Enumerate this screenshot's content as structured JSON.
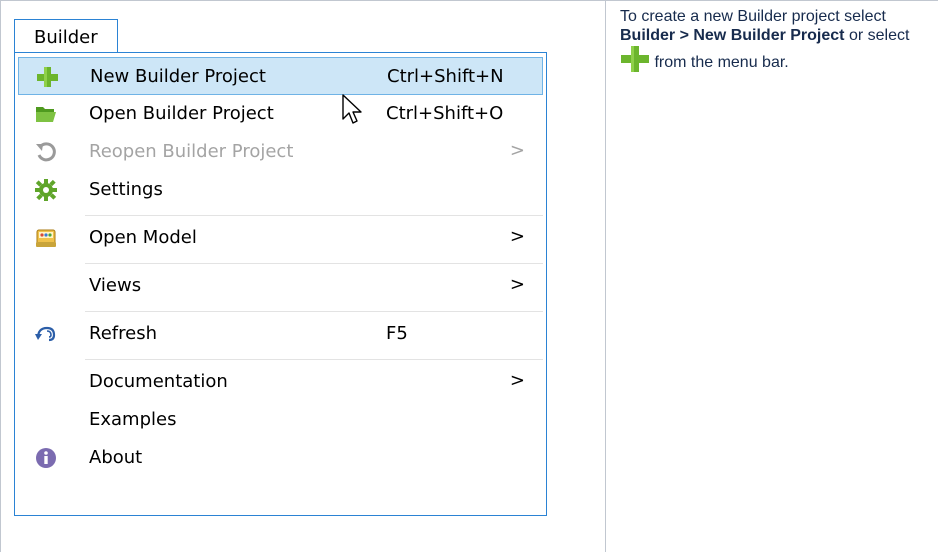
{
  "menu": {
    "title": "Builder",
    "items": [
      {
        "label": "New Builder Project",
        "shortcut": "Ctrl+Shift+N",
        "icon": "green-plus-icon",
        "highlighted": true
      },
      {
        "label": "Open Builder Project",
        "shortcut": "Ctrl+Shift+O",
        "icon": "open-folder-icon"
      },
      {
        "label": "Reopen Builder Project",
        "submenu_arrow": ">",
        "icon": "reopen-icon",
        "disabled": true
      },
      {
        "label": "Settings",
        "icon": "gear-icon"
      },
      {
        "label": "Open Model",
        "submenu_arrow": ">",
        "icon": "model-icon"
      },
      {
        "label": "Views",
        "submenu_arrow": ">"
      },
      {
        "label": "Refresh",
        "shortcut": "F5",
        "icon": "refresh-icon"
      },
      {
        "label": "Documentation",
        "submenu_arrow": ">"
      },
      {
        "label": "Examples"
      },
      {
        "label": "About",
        "icon": "info-icon"
      }
    ]
  },
  "description": {
    "part1": "To create a new Builder project select ",
    "bold1": "Builder > New Builder Project",
    "part2": " or select ",
    "part3": " from the menu bar."
  },
  "colors": {
    "highlight_bg": "#cde6f7",
    "highlight_border": "#6fb3e6",
    "menu_border": "#2b83d4",
    "disabled_text": "#a4a4a4",
    "text": "#172b4d"
  }
}
